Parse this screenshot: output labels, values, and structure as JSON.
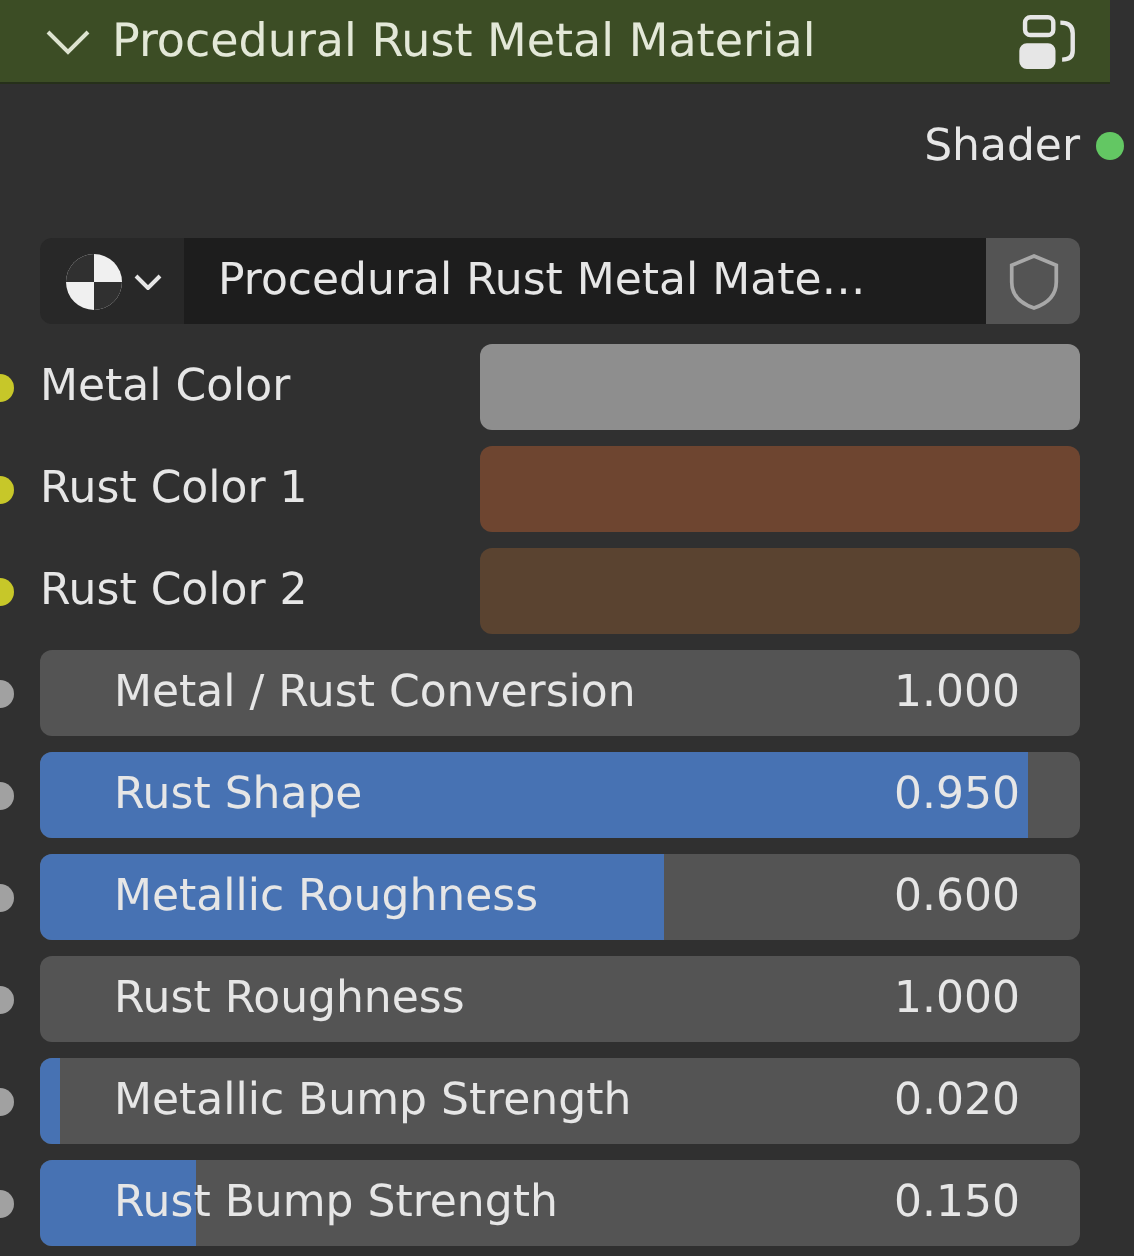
{
  "node": {
    "title": "Procedural Rust Metal Material",
    "expanded": true
  },
  "outputs": [
    {
      "label": "Shader",
      "color": "#63c763"
    }
  ],
  "material": {
    "name": "Procedural Rust Metal Mate…"
  },
  "inputs": [
    {
      "kind": "color",
      "label": "Metal Color",
      "color": "#8e8e8e"
    },
    {
      "kind": "color",
      "label": "Rust Color 1",
      "color": "#6e4530"
    },
    {
      "kind": "color",
      "label": "Rust Color 2",
      "color": "#5a4330"
    },
    {
      "kind": "slider",
      "label": "Metal / Rust Conversion",
      "reading": "1.000"
    },
    {
      "kind": "slider",
      "label": "Rust Shape",
      "reading": "0.950",
      "level": 0.95
    },
    {
      "kind": "slider",
      "label": "Metallic Roughness",
      "reading": "0.600",
      "level": 0.6
    },
    {
      "kind": "slider",
      "label": "Rust Roughness",
      "reading": "1.000"
    },
    {
      "kind": "slider",
      "label": "Metallic Bump Strength",
      "reading": "0.020",
      "level": 0.02
    },
    {
      "kind": "slider",
      "label": "Rust Bump Strength",
      "reading": "0.150",
      "level": 0.15
    }
  ]
}
